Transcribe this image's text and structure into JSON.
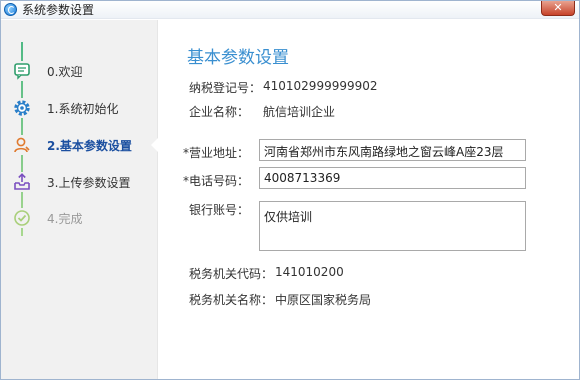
{
  "window": {
    "title": "系统参数设置",
    "close_label": "✕"
  },
  "steps": [
    {
      "label": "0.欢迎",
      "icon": "chat-bubble-icon",
      "state": "done"
    },
    {
      "label": "1.系统初始化",
      "icon": "gear-icon",
      "state": "done"
    },
    {
      "label": "2.基本参数设置",
      "icon": "user-icon",
      "state": "active"
    },
    {
      "label": "3.上传参数设置",
      "icon": "upload-tray-icon",
      "state": "todo"
    },
    {
      "label": "4.完成",
      "icon": "check-circle-icon",
      "state": "disabled"
    }
  ],
  "form": {
    "heading": "基本参数设置",
    "tax_id_label": "纳税登记号：",
    "tax_id_value": "410102999999902",
    "company_label": "企业名称：",
    "company_value": "航信培训企业",
    "address_label": "*营业地址：",
    "address_value": "河南省郑州市东风南路绿地之窗云峰A座23层",
    "phone_label": "*电话号码：",
    "phone_value": "4008713369",
    "bank_label": "银行账号：",
    "bank_value": "仅供培训",
    "tax_office_code_label": "税务机关代码：",
    "tax_office_code_value": "141010200",
    "tax_office_name_label": "税务机关名称：",
    "tax_office_name_value": "中原区国家税务局"
  },
  "colors": {
    "heading": "#3a8fd0",
    "active_step": "#1b4fa0",
    "timeline": "#4fb985",
    "sidebar_bg": "#f1f1f1"
  }
}
